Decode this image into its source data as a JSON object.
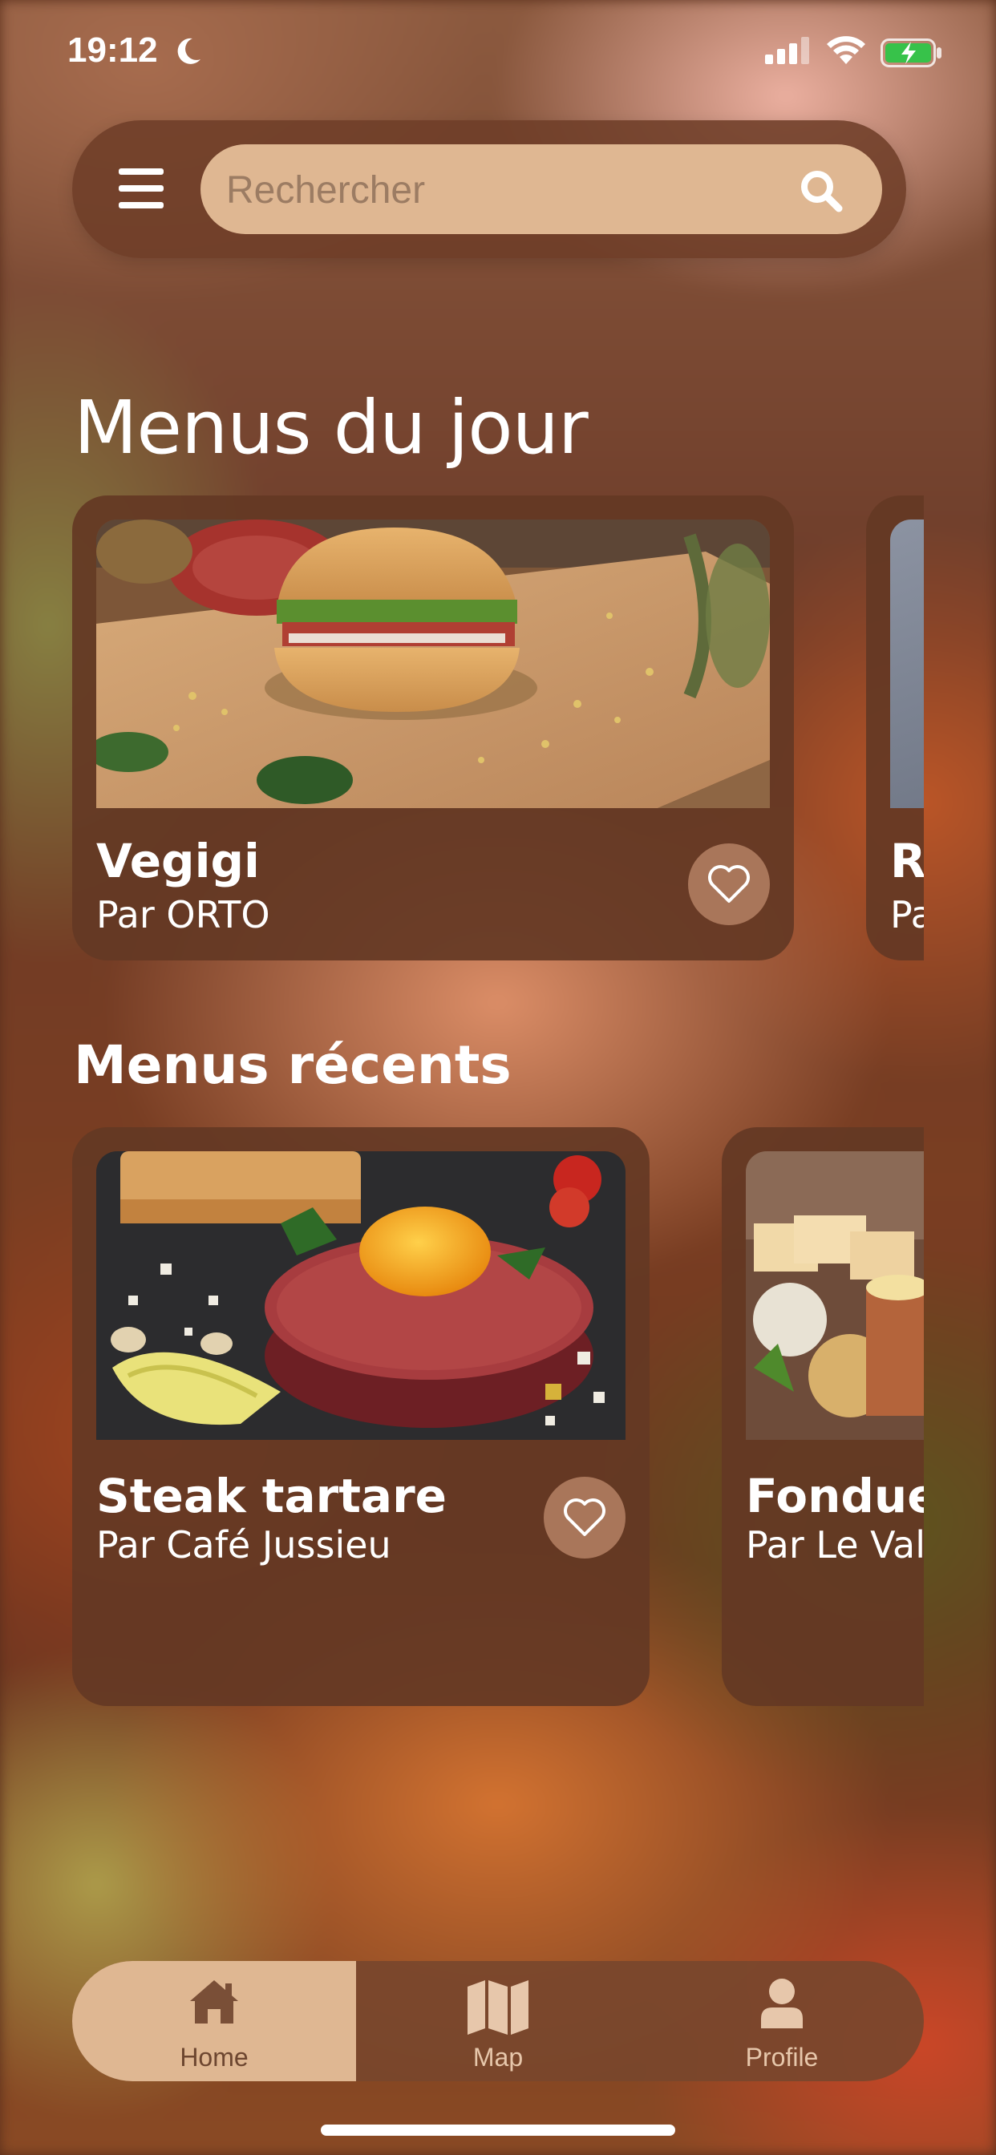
{
  "status_bar": {
    "time": "19:12"
  },
  "search": {
    "placeholder": "Rechercher"
  },
  "sections": {
    "daily": {
      "title": "Menus du jour",
      "cards": [
        {
          "name": "Vegigi",
          "by": "Par ORTO"
        },
        {
          "name": "R",
          "by": "Pa"
        }
      ]
    },
    "recent": {
      "title": "Menus récents",
      "cards": [
        {
          "name": "Steak tartare",
          "by": "Par Café Jussieu"
        },
        {
          "name": "Fondue s",
          "by": "Par Le Valm"
        }
      ]
    }
  },
  "tabbar": {
    "tabs": [
      {
        "label": "Home",
        "icon": "home-icon",
        "active": true
      },
      {
        "label": "Map",
        "icon": "map-icon",
        "active": false
      },
      {
        "label": "Profile",
        "icon": "user-icon",
        "active": false
      }
    ]
  },
  "colors": {
    "accent": "#dfb792",
    "card": "#643824",
    "heart_button": "#a9765a"
  }
}
